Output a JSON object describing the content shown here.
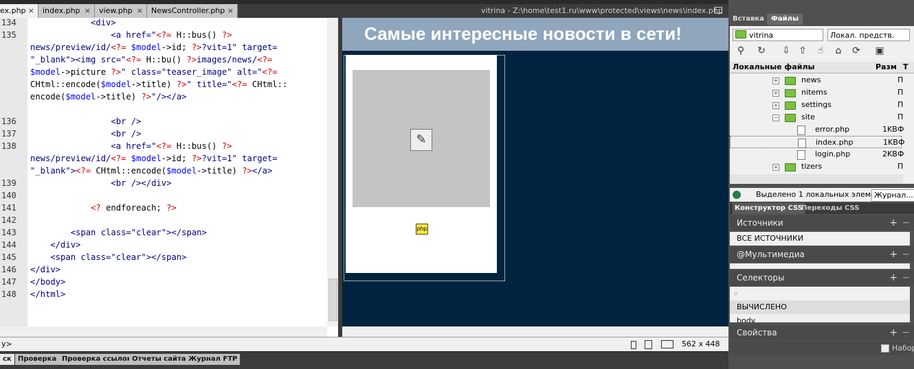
{
  "tabs": [
    {
      "label": "ex.php",
      "active": true
    },
    {
      "label": "index.php"
    },
    {
      "label": "view.php"
    },
    {
      "label": "NewsController.php"
    }
  ],
  "tab_close": "×",
  "document_path": "vitrina - Z:\\home\\test1.ru\\www\\protected\\views\\news\\index.php",
  "code": {
    "line_numbers": [
      "134",
      "135",
      "",
      "",
      "",
      "",
      "",
      "136",
      "137",
      "138",
      "",
      "",
      "139",
      "140",
      "141",
      "142",
      "143",
      "144",
      "145",
      "146",
      "147",
      "148"
    ]
  },
  "design": {
    "banner_title": "Самые интересные новости в сети!",
    "php_marker": "php"
  },
  "status": {
    "tag": "y>",
    "dimensions": "562 x 448 ÷"
  },
  "bottom_tabs": [
    "ск",
    "Проверка",
    "Проверка ссылок",
    "Отчеты сайта",
    "Журнал FTP"
  ],
  "right_panel": {
    "tabs": [
      "Вставка",
      "Файлы"
    ],
    "site_select": "vitrina",
    "view_select": "Локал. предств.",
    "header_name": "Локальные файлы",
    "header_size": "Разм",
    "header_type": "Т",
    "files": [
      {
        "name": "news",
        "type": "folder",
        "size": "",
        "t": "П"
      },
      {
        "name": "nitems",
        "type": "folder",
        "size": "",
        "t": "П"
      },
      {
        "name": "settings",
        "type": "folder",
        "size": "",
        "t": "П"
      },
      {
        "name": "site",
        "type": "folder-open",
        "size": "",
        "t": "П"
      },
      {
        "name": "error.php",
        "type": "file",
        "size": "1KB",
        "t": "Ф"
      },
      {
        "name": "index.php",
        "type": "file",
        "size": "1KB",
        "t": "Ф"
      },
      {
        "name": "login.php",
        "type": "file",
        "size": "2KB",
        "t": "Ф"
      },
      {
        "name": "tizers",
        "type": "folder",
        "size": "",
        "t": "П"
      }
    ],
    "status_text": "Выделено 1 локальных элеме",
    "log_button": "Журнал...",
    "css_tabs": [
      "Конструктор CSS",
      "Переходы CSS"
    ],
    "sections": {
      "sources": "Источники",
      "all_sources": "ВСЕ ИСТОЧНИКИ",
      "media": "@Мультимедиа",
      "selectors": "Селекторы",
      "computed": "ВЫЧИСЛЕНО",
      "body": "body",
      "properties": "Свойства",
      "set": "Набор"
    }
  }
}
